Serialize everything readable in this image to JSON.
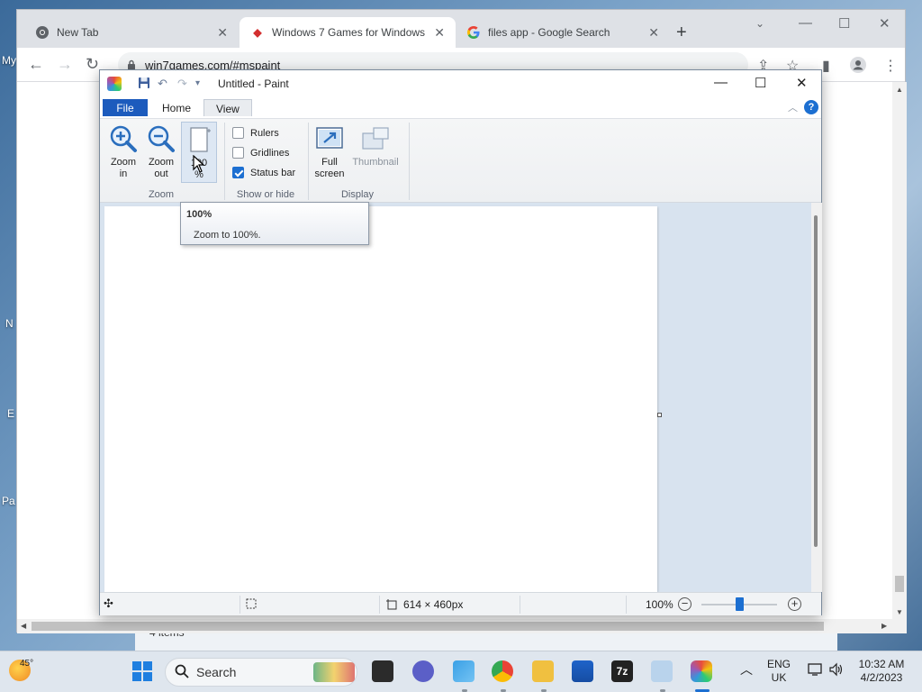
{
  "desktop": {
    "labels": [
      "My",
      "N",
      "E",
      "Pa"
    ],
    "explorer_status": "4 items"
  },
  "browser": {
    "tabs": [
      {
        "title": "New Tab",
        "icon": "chrome-icon"
      },
      {
        "title": "Windows 7 Games for Windows",
        "icon": "win7games-icon"
      },
      {
        "title": "files app - Google Search",
        "icon": "google-icon"
      }
    ],
    "active_tab": 1,
    "url": "win7games.com/#mspaint"
  },
  "paint": {
    "title": "Untitled - Paint",
    "ribbon_tabs": {
      "file": "File",
      "home": "Home",
      "view": "View"
    },
    "active_ribbon_tab": "View",
    "zoom_group": {
      "label": "Zoom",
      "zoom_in": [
        "Zoom",
        "in"
      ],
      "zoom_out": [
        "Zoom",
        "out"
      ],
      "hundred": [
        "100",
        "%"
      ]
    },
    "show_hide_group": {
      "label": "Show or hide",
      "rulers": {
        "label": "Rulers",
        "checked": false
      },
      "gridlines": {
        "label": "Gridlines",
        "checked": false
      },
      "status_bar": {
        "label": "Status bar",
        "checked": true
      }
    },
    "display_group": {
      "label": "Display",
      "full_screen": [
        "Full",
        "screen"
      ],
      "thumbnail": "Thumbnail"
    },
    "tooltip": {
      "title": "100%",
      "body": "Zoom to 100%."
    },
    "status": {
      "canvas_size": "614 × 460px",
      "zoom": "100%"
    },
    "colors": {
      "accent": "#1c5bbd",
      "canvas_bg": "#d8e3ef"
    }
  },
  "taskbar": {
    "weather": "45°",
    "search_placeholder": "Search",
    "lang": [
      "ENG",
      "UK"
    ],
    "time": "10:32 AM",
    "date": "4/2/2023"
  }
}
